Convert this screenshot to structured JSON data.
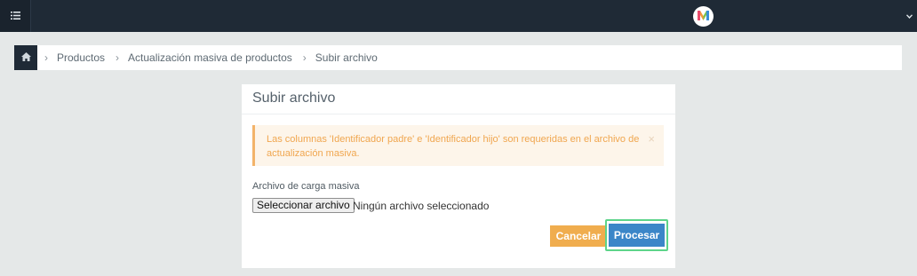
{
  "topbar": {
    "menu_icon": "list-icon",
    "logo_icon": "brand-m-logo-icon",
    "caret_icon": "chevron-down-icon"
  },
  "breadcrumb": {
    "home_icon": "home-icon",
    "items": [
      "Productos",
      "Actualización masiva de productos",
      "Subir archivo"
    ]
  },
  "panel": {
    "title": "Subir archivo",
    "alert": {
      "text": "Las columnas 'Identificador padre' e 'Identificador hijo' son requeridas en el archivo de actualización masiva.",
      "close": "×"
    },
    "file_field": {
      "label": "Archivo de carga masiva",
      "button_label": "Seleccionar archivo",
      "status": "Ningún archivo seleccionado"
    },
    "actions": {
      "cancel_label": "Cancelar",
      "process_label": "Procesar"
    }
  },
  "colors": {
    "topbar": "#1f2a36",
    "warning": "#f0ad4e",
    "primary": "#3b86c8",
    "highlight": "#5dd48a"
  }
}
